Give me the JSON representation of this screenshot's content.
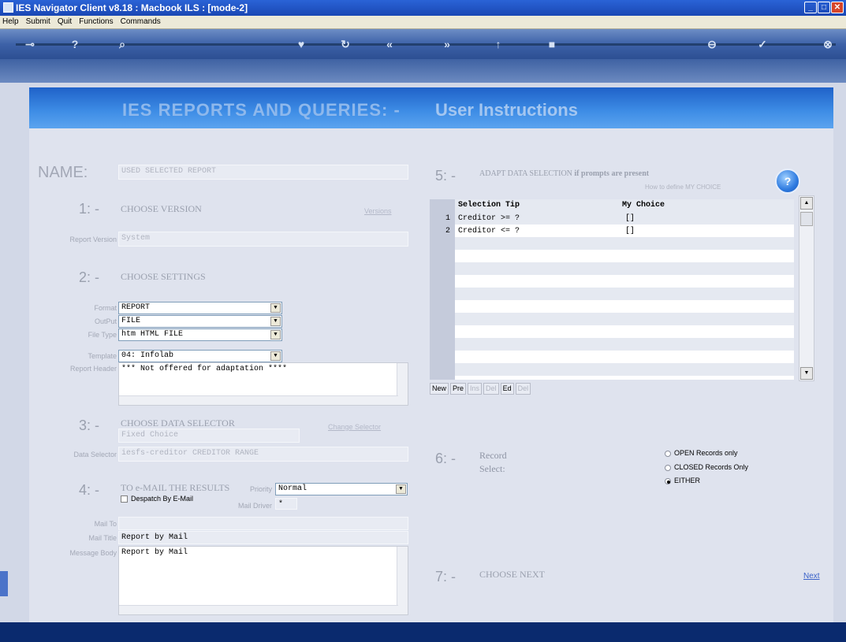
{
  "window": {
    "title": "IES Navigator Client v8.18 : Macbook ILS :     [mode-2]"
  },
  "menubar": [
    "Help",
    "Submit",
    "Quit",
    "Functions",
    "Commands"
  ],
  "header": {
    "title": "IES REPORTS AND QUERIES: -",
    "subtitle": "User Instructions"
  },
  "name": {
    "label": "NAME:",
    "value": "USED SELECTED REPORT"
  },
  "section1": {
    "num": "1: -",
    "title": "CHOOSE VERSION",
    "link": "Versions",
    "report_version_label": "Report Version",
    "report_version_value": "System"
  },
  "section2": {
    "num": "2: -",
    "title": "CHOOSE SETTINGS",
    "format_label": "Format",
    "format_value": "REPORT",
    "output_label": "OutPut",
    "output_value": "FILE",
    "filetype_label": "File Type",
    "filetype_value": "htm HTML FILE",
    "template_label": "Template",
    "template_value": "04: Infolab",
    "header_label": "Report Header",
    "header_value": "*** Not offered for adaptation ****"
  },
  "section3": {
    "num": "3: -",
    "title": "CHOOSE DATA SELECTOR",
    "link": "Change Selector",
    "choice_value": "Fixed Choice",
    "selector_label": "Data Selector",
    "selector_value": "iesfs-creditor CREDITOR RANGE"
  },
  "section4": {
    "num": "4: -",
    "title": "TO e-MAIL THE RESULTS",
    "priority_label": "Priority",
    "priority_value": "Normal",
    "despatch_label": "Despatch By E-Mail",
    "maildriver_label": "Mail Driver",
    "maildriver_value": "*",
    "mailto_label": "Mail To",
    "mailto_value": "",
    "mailtitle_label": "Mail Title",
    "mailtitle_value": "Report by Mail",
    "body_label": "Message Body",
    "body_value": "Report by Mail"
  },
  "section5": {
    "num": "5: -",
    "title": "ADAPT DATA SELECTION",
    "title_suffix": "if prompts are present",
    "help_text": "How to define MY CHOICE",
    "col_tip": "Selection Tip",
    "col_choice": "My Choice",
    "rows": [
      {
        "n": "1",
        "tip": "Creditor >= ?",
        "choice": "[]"
      },
      {
        "n": "2",
        "tip": "Creditor <= ?",
        "choice": "[]"
      }
    ],
    "buttons": [
      "New",
      "Pre",
      "Ins",
      "Del",
      "Ed",
      "Del"
    ]
  },
  "section6": {
    "num": "6: -",
    "title": "Record",
    "title2": "Select:",
    "options": [
      "OPEN Records only",
      "CLOSED Records Only",
      "EITHER"
    ],
    "selected": "EITHER"
  },
  "section7": {
    "num": "7: -",
    "title": "CHOOSE NEXT",
    "link": "Next"
  }
}
